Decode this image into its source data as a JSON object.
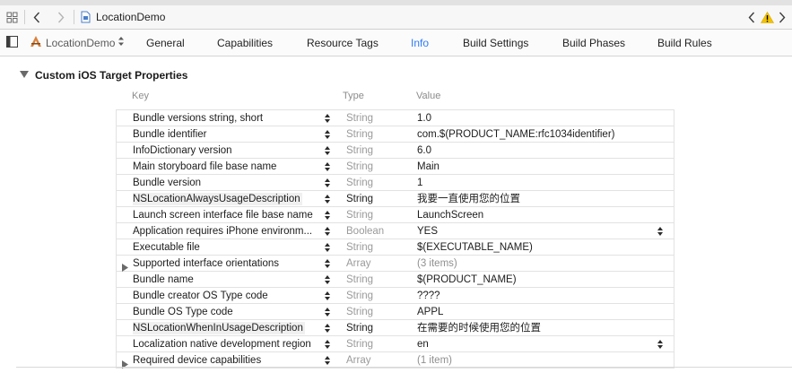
{
  "jumpbar": {
    "grid_icon": "grid-icon",
    "back_icon": "chevron-left-icon",
    "forward_icon": "chevron-right-icon",
    "file_icon": "document-icon",
    "breadcrumb": "LocationDemo",
    "issue_left_icon": "chevron-left-icon",
    "warning_icon": "warning-icon",
    "issue_right_icon": "chevron-right-icon"
  },
  "tabbar": {
    "target_name": "LocationDemo",
    "tabs": [
      {
        "label": "General"
      },
      {
        "label": "Capabilities"
      },
      {
        "label": "Resource Tags"
      },
      {
        "label": "Info",
        "active": true
      },
      {
        "label": "Build Settings"
      },
      {
        "label": "Build Phases"
      },
      {
        "label": "Build Rules"
      }
    ]
  },
  "section": {
    "title": "Custom iOS Target Properties"
  },
  "columns": {
    "key": "Key",
    "type": "Type",
    "value": "Value"
  },
  "rows": [
    {
      "key": "Bundle versions string, short",
      "type": "String",
      "value": "1.0"
    },
    {
      "key": "Bundle identifier",
      "type": "String",
      "value": "com.$(PRODUCT_NAME:rfc1034identifier)"
    },
    {
      "key": "InfoDictionary version",
      "type": "String",
      "value": "6.0"
    },
    {
      "key": "Main storyboard file base name",
      "type": "String",
      "value": "Main"
    },
    {
      "key": "Bundle version",
      "type": "String",
      "value": "1"
    },
    {
      "key": "NSLocationAlwaysUsageDescription",
      "type": "String",
      "value": "我要一直使用您的位置"
    },
    {
      "key": "Launch screen interface file base name",
      "type": "String",
      "value": "LaunchScreen"
    },
    {
      "key": "Application requires iPhone environm...",
      "type": "Boolean",
      "value": "YES"
    },
    {
      "key": "Executable file",
      "type": "String",
      "value": "$(EXECUTABLE_NAME)"
    },
    {
      "key": "Supported interface orientations",
      "type": "Array",
      "value": "(3 items)"
    },
    {
      "key": "Bundle name",
      "type": "String",
      "value": "$(PRODUCT_NAME)"
    },
    {
      "key": "Bundle creator OS Type code",
      "type": "String",
      "value": "????"
    },
    {
      "key": "Bundle OS Type code",
      "type": "String",
      "value": "APPL"
    },
    {
      "key": "NSLocationWhenInUsageDescription",
      "type": "String",
      "value": "在需要的时候使用您的位置"
    },
    {
      "key": "Localization native development region",
      "type": "String",
      "value": "en"
    },
    {
      "key": "Required device capabilities",
      "type": "Array",
      "value": "(1 item)"
    }
  ]
}
